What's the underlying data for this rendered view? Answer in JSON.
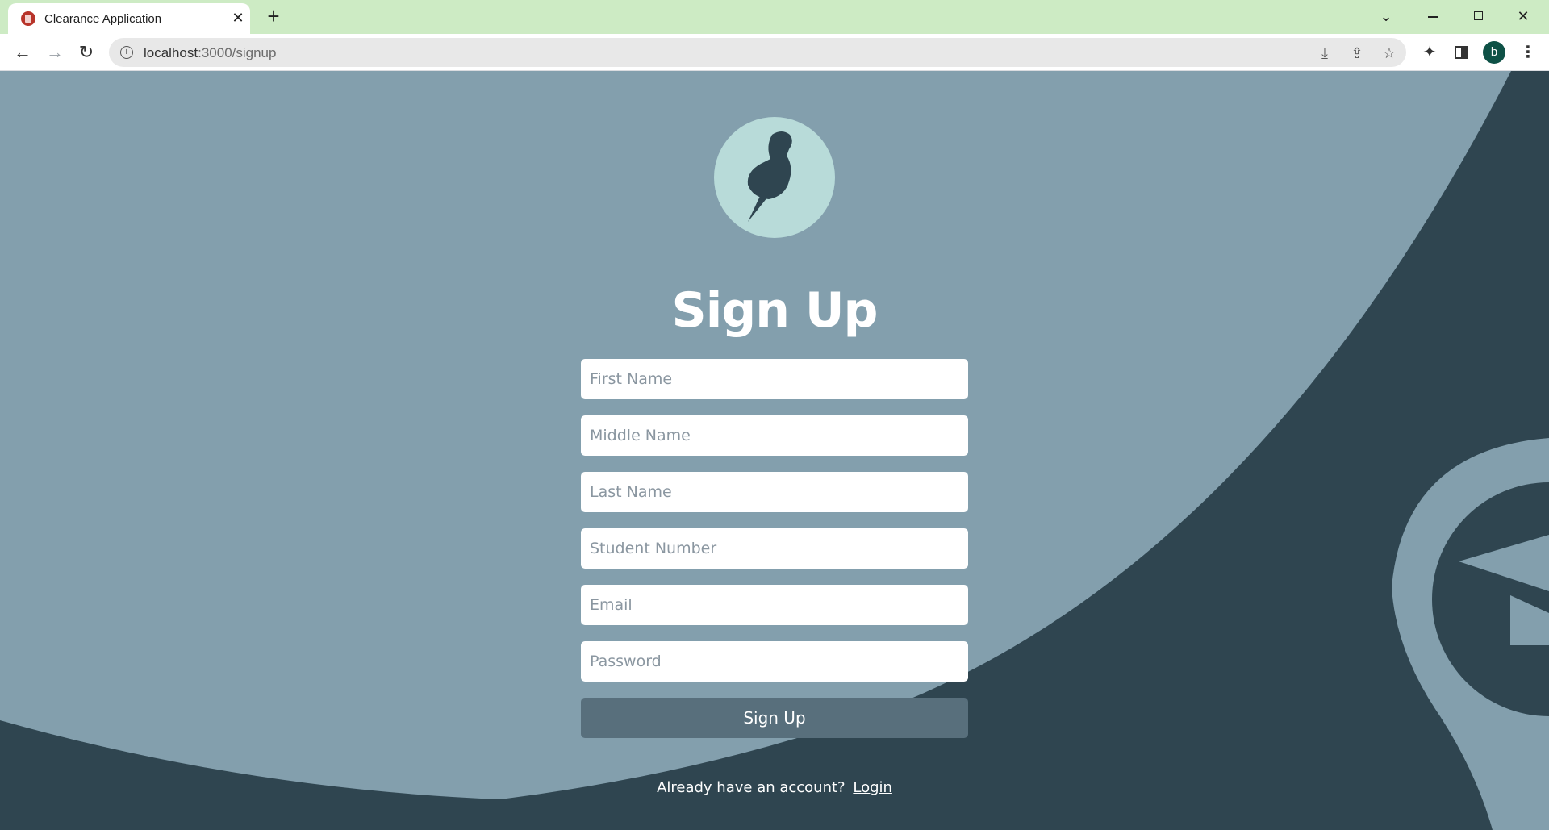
{
  "browser": {
    "tab_title": "Clearance Application",
    "url_host": "localhost",
    "url_path": ":3000/signup"
  },
  "page": {
    "heading": "Sign Up",
    "fields": {
      "first_name": "First Name",
      "middle_name": "Middle Name",
      "last_name": "Last Name",
      "student_number": "Student Number",
      "email": "Email",
      "password": "Password"
    },
    "submit_label": "Sign Up",
    "footer_prompt": "Already have an account?",
    "footer_link": "Login",
    "avatar_letter": "b"
  },
  "colors": {
    "background_light": "#839fad",
    "background_dark": "#2f4550",
    "logo_circle": "#b8dbd9",
    "button": "#586f7c",
    "browser_tabbar": "#cdebc4"
  },
  "icons": {
    "logo": "pushpin-icon"
  }
}
